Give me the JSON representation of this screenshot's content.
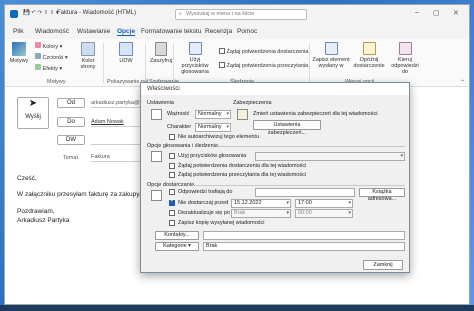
{
  "window": {
    "title": "Faktura - Wiadomość (HTML)",
    "search_placeholder": "Wyszukaj w menu i na liście"
  },
  "menu": [
    "Plik",
    "Wiadomość",
    "Wstawianie",
    "Opcje",
    "Formatowanie tekstu",
    "Recenzja",
    "Pomoc"
  ],
  "ribbon": {
    "motywy": {
      "main": "Motywy",
      "kolory": "Kolory",
      "czcionki": "Czcionki",
      "efekty": "Efekty",
      "kolor_strony": "Kolor strony",
      "group": "Motywy"
    },
    "pokazywanie": {
      "udw": "UDW",
      "group": "Pokazywanie pól"
    },
    "szyfrowanie": {
      "zaszyfruj": "Zaszyfruj",
      "group": "Szyfrowanie"
    },
    "sledzenie": {
      "przyciski": "Użyj przycisków głosowania",
      "potwierdzenie_dostarczenia": "Żądaj potwierdzenia dostarczenia",
      "potwierdzenie_przeczytania": "Żądaj potwierdzenia przeczytania",
      "group": "Śledzenie"
    },
    "wiecej": {
      "zapisz": "Zapisz element wysłany w",
      "opoznij": "Opóźnij dostarczenie",
      "kieruj": "Kieruj odpowiedzi do",
      "group": "Więcej opcji"
    }
  },
  "compose": {
    "send": "Wyślij",
    "from_btn": "Od",
    "from_value": "arkadiusz.partyka@...",
    "to_btn": "Do",
    "to_value": "Adam Nowak",
    "cc_btn": "DW",
    "subject_label": "Temat",
    "subject_value": "Faktura",
    "body": [
      "Cześć,",
      "W załączniku przesyłam fakturę za zakupy.",
      "Pozdrawiam,",
      "Arkadiusz Partyka"
    ]
  },
  "dialog": {
    "title": "Właściwości",
    "ustawienia": {
      "header": "Ustawienia",
      "waznosc_label": "Ważność",
      "waznosc_value": "Normalny",
      "charakter_label": "Charakter",
      "charakter_value": "Normalny"
    },
    "zabezpieczenia": {
      "header": "Zabezpieczenia",
      "info": "Zmień ustawienia zabezpieczeń dla tej wiadomości.",
      "button": "Ustawienia zabezpieczeń..."
    },
    "autoarchive": "Nie autoarchiwizuj tego elementu",
    "glosowanie": {
      "header": "Opcje głosowania i śledzenia",
      "uzyj": "Użyj przycisków głosowania",
      "dostarczenia": "Żądaj potwierdzenia dostarczenia dla tej wiadomości",
      "przeczytania": "Żądaj potwierdzenia przeczytania dla tej wiadomości"
    },
    "dostarczanie": {
      "header": "Opcje dostarczania",
      "odpowiedz": "Odpowiedzi trafiają do",
      "ksiazka": "Książka adresowa...",
      "nie_dostarczaj": "Nie dostarczaj przed",
      "nie_dostarczaj_date": "15.12.2022",
      "nie_dostarczaj_time": "17:00",
      "dezaktualizuje": "Dezaktualizuje się po",
      "dez_date": "Brak",
      "dez_time": "00:00",
      "kopia": "Zapisz kopię wysyłanej wiadomości"
    },
    "kontakty": "Kontakty...",
    "kategorie": "Kategorie",
    "kategorie_value": "Brak",
    "zamknij": "Zamknij"
  },
  "colors": {
    "accent": "#0f5fb5",
    "desktop": "#3a7fd0"
  }
}
